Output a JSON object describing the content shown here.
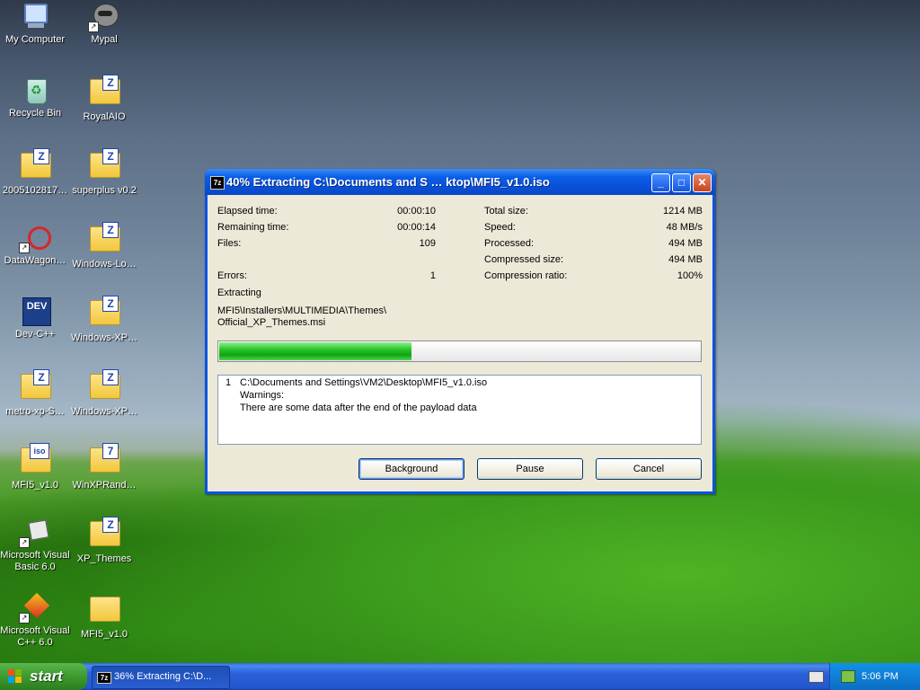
{
  "desktop": {
    "icons": [
      {
        "label": "My Computer",
        "kind": "computer-icon"
      },
      {
        "label": "Mypal",
        "kind": "raccoon-icon"
      },
      {
        "label": "Recycle Bin",
        "kind": "recycle-bin-icon"
      },
      {
        "label": "RoyalAIO",
        "kind": "zip-folder-icon"
      },
      {
        "label": "2005102817…",
        "kind": "zip-folder-icon"
      },
      {
        "label": "superplus v0.2",
        "kind": "zip-folder-icon"
      },
      {
        "label": "DataWagon…",
        "kind": "datawagon-shortcut-icon"
      },
      {
        "label": "Windows-Lo…",
        "kind": "zip-folder-icon"
      },
      {
        "label": "Dev-C++",
        "kind": "devcpp-icon"
      },
      {
        "label": "Windows-XP…",
        "kind": "zip-folder-icon"
      },
      {
        "label": "metro-xp-S…",
        "kind": "zip-folder-icon"
      },
      {
        "label": "Windows-XP…",
        "kind": "zip-folder-icon"
      },
      {
        "label": "MFI5_v1.0",
        "kind": "iso-file-icon"
      },
      {
        "label": "WinXPRand…",
        "kind": "7z-archive-icon"
      },
      {
        "label": "Microsoft Visual Basic 6.0",
        "kind": "vb6-shortcut-icon"
      },
      {
        "label": "XP_Themes",
        "kind": "zip-folder-icon"
      },
      {
        "label": "Microsoft Visual C++ 6.0",
        "kind": "vcpp-shortcut-icon"
      },
      {
        "label": "MFI5_v1.0",
        "kind": "folder-icon"
      }
    ]
  },
  "dialog": {
    "title": "40% Extracting C:\\Documents and S … ktop\\MFI5_v1.0.iso",
    "app_icon_text": "7z",
    "left_stats": [
      {
        "label": "Elapsed time:",
        "value": "00:00:10"
      },
      {
        "label": "Remaining time:",
        "value": "00:00:14"
      },
      {
        "label": "Files:",
        "value": "109"
      },
      {
        "label": "Errors:",
        "value": "1"
      }
    ],
    "right_stats": [
      {
        "label": "Total size:",
        "value": "1214 MB"
      },
      {
        "label": "Speed:",
        "value": "48 MB/s"
      },
      {
        "label": "Processed:",
        "value": "494 MB"
      },
      {
        "label": "Compressed size:",
        "value": "494 MB"
      },
      {
        "label": "Compression ratio:",
        "value": "100%"
      }
    ],
    "extracting_label": "Extracting",
    "current_file_line1": "MFI5\\Installers\\MULTIMEDIA\\Themes\\",
    "current_file_line2": "Official_XP_Themes.msi",
    "progress_fraction": 0.4,
    "log": {
      "index": "1",
      "path": "C:\\Documents and Settings\\VM2\\Desktop\\MFI5_v1.0.iso",
      "warnings_label": "Warnings:",
      "message": "There are some data after the end of the payload data"
    },
    "buttons": {
      "background": "Background",
      "pause": "Pause",
      "cancel": "Cancel"
    },
    "controls": {
      "minimize": "_",
      "maximize": "□",
      "close": "✕"
    }
  },
  "taskbar": {
    "start_label": "start",
    "task_icon_text": "7z",
    "task_label": "36% Extracting C:\\D...",
    "clock": "5:06 PM"
  },
  "colors": {
    "xp_blue": "#0a54e3",
    "progress_green": "#10a313",
    "start_green": "#3d9a2e"
  }
}
